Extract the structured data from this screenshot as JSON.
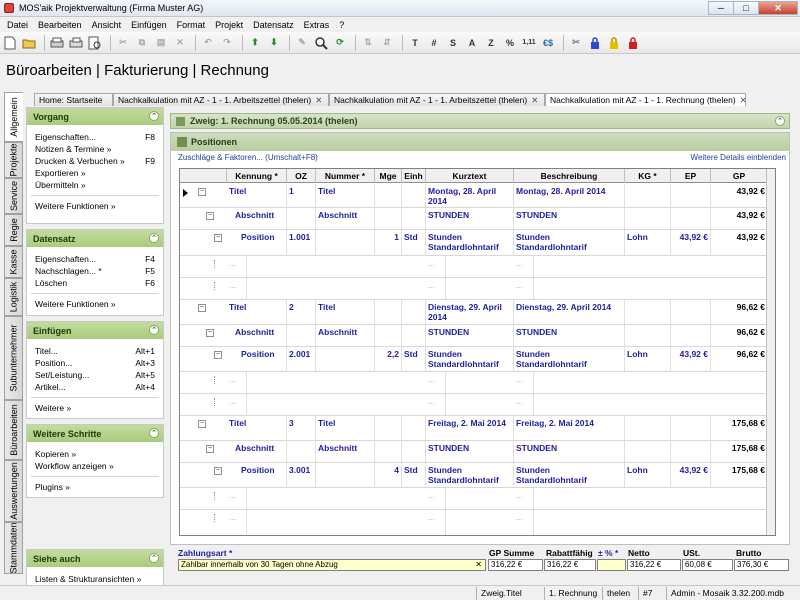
{
  "window": {
    "title": "MOS'aik Projektverwaltung (Firma Muster AG)",
    "min": "─",
    "max": "□",
    "close": "✕"
  },
  "menu": [
    "Datei",
    "Bearbeiten",
    "Ansicht",
    "Einfügen",
    "Format",
    "Projekt",
    "Datensatz",
    "Extras",
    "?"
  ],
  "toolbar": {
    "t_bold": "T",
    "t_hash": "#",
    "t_s": "S",
    "t_a": "A",
    "t_z": "Z",
    "t_pct": "%",
    "t_num": "1,11",
    "t_euro": "€$"
  },
  "page_title": "Büroarbeiten | Fakturierung | Rechnung",
  "vtabs": [
    "Allgemein",
    "Projekte",
    "Service",
    "Regie",
    "Kasse",
    "Logistik",
    "Subunternehmer",
    "Büroarbeiten",
    "Auswertungen",
    "Stammdaten"
  ],
  "tabs": [
    {
      "label": "Home: Startseite"
    },
    {
      "label": "Nachkalkulation mit AZ - 1 - 1. Arbeitszettel (thelen)",
      "close": "✕"
    },
    {
      "label": "Nachkalkulation mit AZ - 1 - 1. Arbeitszettel (thelen)",
      "close": "✕"
    },
    {
      "label": "Nachkalkulation mit AZ - 1 - 1. Rechnung (thelen)",
      "close": "✕"
    }
  ],
  "sidebar": {
    "vorgang": {
      "title": "Vorgang",
      "items": [
        {
          "label": "Eigenschaften...",
          "key": "F8"
        },
        {
          "label": "Notizen & Termine »",
          "key": ""
        },
        {
          "label": "Drucken & Verbuchen »",
          "key": "F9"
        },
        {
          "label": "Exportieren »",
          "key": ""
        },
        {
          "label": "Übermitteln »",
          "key": ""
        }
      ],
      "more": "Weitere Funktionen »"
    },
    "datensatz": {
      "title": "Datensatz",
      "items": [
        {
          "label": "Eigenschaften...",
          "key": "F4"
        },
        {
          "label": "Nachschlagen... *",
          "key": "F5"
        },
        {
          "label": "Löschen",
          "key": "F6"
        }
      ],
      "more": "Weitere Funktionen »"
    },
    "einfuegen": {
      "title": "Einfügen",
      "items": [
        {
          "label": "Titel...",
          "key": "Alt+1"
        },
        {
          "label": "Position...",
          "key": "Alt+3"
        },
        {
          "label": "Set/Leistung...",
          "key": "Alt+5"
        },
        {
          "label": "Artikel...",
          "key": "Alt+4"
        }
      ],
      "more": "Weitere »"
    },
    "schritte": {
      "title": "Weitere Schritte",
      "items": [
        {
          "label": "Kopieren »",
          "key": ""
        },
        {
          "label": "Workflow anzeigen »",
          "key": ""
        }
      ],
      "more": "Plugins »"
    },
    "siehe": {
      "title": "Siehe auch",
      "items": [
        {
          "label": "Listen & Strukturansichten »",
          "key": ""
        }
      ]
    }
  },
  "zweig": "Zweig: 1. Rechnung 05.05.2014 (thelen)",
  "positions": {
    "title": "Positionen",
    "link_left": "Zuschläge & Faktoren... (Umschalt+F8)",
    "link_right": "Weitere Details einblenden",
    "columns": [
      "Kennung *",
      "OZ",
      "Nummer *",
      "Mge",
      "Einh",
      "Kurztext",
      "Beschreibung",
      "KG *",
      "EP",
      "GP"
    ],
    "rows": [
      {
        "kennung": "Titel",
        "oz": "1",
        "nummer": "Titel",
        "mge": "",
        "einh": "",
        "kurz": "Montag, 28. April 2014",
        "besch": "Montag, 28. April 2014",
        "kg": "",
        "ep": "",
        "gp": "43,92 €"
      },
      {
        "kennung": "Abschnitt",
        "oz": "",
        "nummer": "Abschnitt",
        "mge": "",
        "einh": "",
        "kurz": "STUNDEN",
        "besch": "STUNDEN",
        "kg": "",
        "ep": "",
        "gp": "43,92 €"
      },
      {
        "kennung": "Position",
        "oz": "1.001",
        "nummer": "",
        "mge": "1",
        "einh": "Std",
        "kurz": "Stunden Standardlohntarif",
        "besch": "Stunden Standardlohntarif",
        "kg": "Lohn",
        "ep": "43,92 €",
        "gp": "43,92 €"
      },
      {
        "kennung": "Titel",
        "oz": "2",
        "nummer": "Titel",
        "mge": "",
        "einh": "",
        "kurz": "Dienstag, 29. April 2014",
        "besch": "Dienstag, 29. April 2014",
        "kg": "",
        "ep": "",
        "gp": "96,62 €"
      },
      {
        "kennung": "Abschnitt",
        "oz": "",
        "nummer": "Abschnitt",
        "mge": "",
        "einh": "",
        "kurz": "STUNDEN",
        "besch": "STUNDEN",
        "kg": "",
        "ep": "",
        "gp": "96,62 €"
      },
      {
        "kennung": "Position",
        "oz": "2.001",
        "nummer": "",
        "mge": "2,2",
        "einh": "Std",
        "kurz": "Stunden Standardlohntarif",
        "besch": "Stunden Standardlohntarif",
        "kg": "Lohn",
        "ep": "43,92 €",
        "gp": "96,62 €"
      },
      {
        "kennung": "Titel",
        "oz": "3",
        "nummer": "Titel",
        "mge": "",
        "einh": "",
        "kurz": "Freitag, 2. Mai 2014",
        "besch": "Freitag, 2. Mai 2014",
        "kg": "",
        "ep": "",
        "gp": "175,68 €"
      },
      {
        "kennung": "Abschnitt",
        "oz": "",
        "nummer": "Abschnitt",
        "mge": "",
        "einh": "",
        "kurz": "STUNDEN",
        "besch": "STUNDEN",
        "kg": "",
        "ep": "",
        "gp": "175,68 €"
      },
      {
        "kennung": "Position",
        "oz": "3.001",
        "nummer": "",
        "mge": "4",
        "einh": "Std",
        "kurz": "Stunden Standardlohntarif",
        "besch": "Stunden Standardlohntarif",
        "kg": "Lohn",
        "ep": "43,92 €",
        "gp": "175,68 €"
      }
    ]
  },
  "footer": {
    "zahlungsart_label": "Zahlungsart *",
    "zahlungsart_value": "Zahlbar innerhalb von 30 Tagen ohne Abzug",
    "clear": "✕",
    "gp_summe_label": "GP Summe",
    "gp_summe": "316,22 €",
    "rabatt_label": "Rabattfähig",
    "rabatt": "316,22 €",
    "pct_label": "± % *",
    "pct": "",
    "netto_label": "Netto",
    "netto": "316,22 €",
    "ust_label": "USt.",
    "ust": "60,08 €",
    "brutto_label": "Brutto",
    "brutto": "376,30 €"
  },
  "status": [
    "Zweig.Titel",
    "1. Rechnung",
    "thelen",
    "#7",
    "Admin - Mosaik 3.32.200.mdb"
  ]
}
